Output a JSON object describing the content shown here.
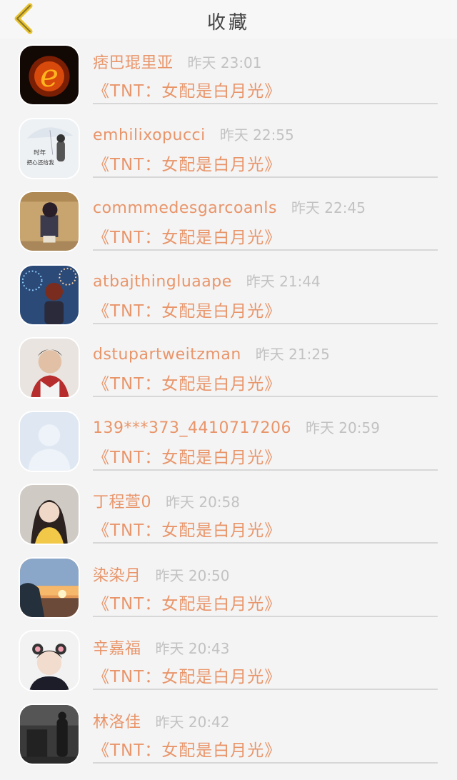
{
  "header": {
    "title": "收藏"
  },
  "colors": {
    "accent": "#e9956a",
    "time": "#c2c2c2",
    "back": "#e8c22a"
  },
  "favorites": [
    {
      "name": "痞巴琨里亚",
      "time": "昨天 23:01",
      "message": "《TNT：女配是白月光》",
      "avatar": "fire-letter-avatar"
    },
    {
      "name": "emhilixopucci",
      "time": "昨天 22:55",
      "message": "《TNT：女配是白月光》",
      "avatar": "umbrella-girl-avatar"
    },
    {
      "name": "commmedesgarcoanls",
      "time": "昨天 22:45",
      "message": "《TNT：女配是白月光》",
      "avatar": "anime-figure-avatar"
    },
    {
      "name": "atbajthingluaape",
      "time": "昨天 21:44",
      "message": "《TNT：女配是白月光》",
      "avatar": "fireworks-anime-avatar"
    },
    {
      "name": "dstupartweitzman",
      "time": "昨天 21:25",
      "message": "《TNT：女配是白月光》",
      "avatar": "young-man-portrait-avatar"
    },
    {
      "name": "139***373_4410717206",
      "time": "昨天 20:59",
      "message": "《TNT：女配是白月光》",
      "avatar": "default-user-avatar"
    },
    {
      "name": "丁程萱0",
      "time": "昨天 20:58",
      "message": "《TNT：女配是白月光》",
      "avatar": "girl-yellow-shirt-avatar"
    },
    {
      "name": "染染月",
      "time": "昨天 20:50",
      "message": "《TNT：女配是白月光》",
      "avatar": "sunset-silhouette-avatar"
    },
    {
      "name": "辛嘉福",
      "time": "昨天 20:43",
      "message": "《TNT：女配是白月光》",
      "avatar": "boy-ears-avatar"
    },
    {
      "name": "林洛佳",
      "time": "昨天 20:42",
      "message": "《TNT：女配是白月光》",
      "avatar": "dark-room-avatar"
    }
  ]
}
